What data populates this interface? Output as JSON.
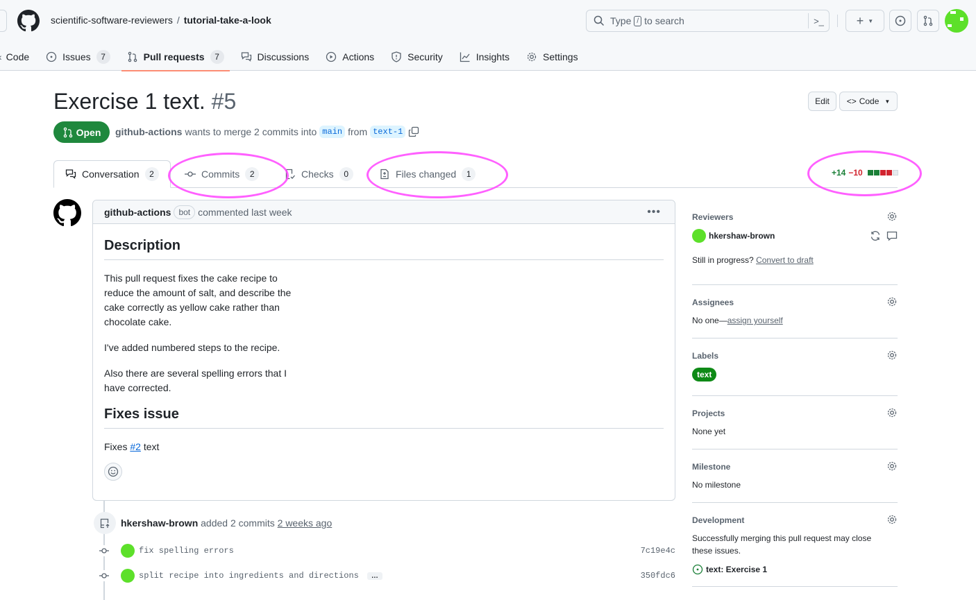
{
  "header": {
    "org": "scientific-software-reviewers",
    "separator": "/",
    "repo": "tutorial-take-a-look",
    "search": {
      "prefix": "Type",
      "key": "/",
      "suffix": "to search"
    },
    "icons": [
      "github-logo",
      "search-icon",
      "command-palette-icon",
      "plus-icon",
      "issues-icon",
      "pull-request-icon",
      "user-avatar"
    ]
  },
  "nav": [
    {
      "label": "Code",
      "icon": "code-icon"
    },
    {
      "label": "Issues",
      "count": "7",
      "icon": "issue-icon"
    },
    {
      "label": "Pull requests",
      "count": "7",
      "icon": "pull-request-icon",
      "selected": true
    },
    {
      "label": "Discussions",
      "icon": "discussion-icon"
    },
    {
      "label": "Actions",
      "icon": "play-icon"
    },
    {
      "label": "Security",
      "icon": "shield-icon"
    },
    {
      "label": "Insights",
      "icon": "graph-icon"
    },
    {
      "label": "Settings",
      "icon": "gear-icon"
    }
  ],
  "pr": {
    "title": "Exercise 1 text.",
    "number": "#5",
    "edit_label": "Edit",
    "code_label": "Code",
    "state": "Open",
    "author": "github-actions",
    "merge_text": "wants to merge 2 commits into",
    "base_branch": "main",
    "from_text": "from",
    "head_branch": "text-1"
  },
  "tabs": [
    {
      "label": "Conversation",
      "count": "2",
      "selected": true
    },
    {
      "label": "Commits",
      "count": "2"
    },
    {
      "label": "Checks",
      "count": "0"
    },
    {
      "label": "Files changed",
      "count": "1"
    }
  ],
  "diffstat": {
    "additions": "+14",
    "deletions": "−10",
    "blocks": [
      "add",
      "add",
      "del",
      "del",
      "neutral"
    ]
  },
  "colors": {
    "accent_open": "#1f883d",
    "annotation": "#ff44ff",
    "add": "#1a7f37",
    "del": "#d1242f",
    "label_text": "#0e8a16",
    "avatar_green": "#5de02a"
  },
  "comment": {
    "author": "github-actions",
    "badge": "bot",
    "action": "commented last week",
    "h_description": "Description",
    "p1": "This pull request fixes the cake recipe to reduce the amount of salt, and describe the cake correctly as yellow cake rather than chocolate cake.",
    "p2": "I've added numbered steps to the recipe.",
    "p3": "Also there are several spelling errors that I have corrected.",
    "h_fixes": "Fixes issue",
    "fixes_prefix": "Fixes",
    "fixes_link": "#2",
    "fixes_suffix": "text"
  },
  "timeline": {
    "author": "hkershaw-brown",
    "action": "added 2 commits",
    "time": "2 weeks ago",
    "commits": [
      {
        "message": "fix spelling errors",
        "sha": "7c19e4c"
      },
      {
        "message": "split recipe into ingredients and directions",
        "sha": "350fdc6",
        "more": "…"
      }
    ]
  },
  "sidebar": {
    "reviewers": {
      "title": "Reviewers",
      "name": "hkershaw-brown",
      "draft_prefix": "Still in progress?",
      "draft_link": "Convert to draft"
    },
    "assignees": {
      "title": "Assignees",
      "prefix": "No one—",
      "link": "assign yourself"
    },
    "labels": {
      "title": "Labels",
      "items": [
        "text"
      ]
    },
    "projects": {
      "title": "Projects",
      "value": "None yet"
    },
    "milestone": {
      "title": "Milestone",
      "value": "No milestone"
    },
    "development": {
      "title": "Development",
      "text": "Successfully merging this pull request may close these issues.",
      "issue": "text: Exercise 1"
    }
  }
}
